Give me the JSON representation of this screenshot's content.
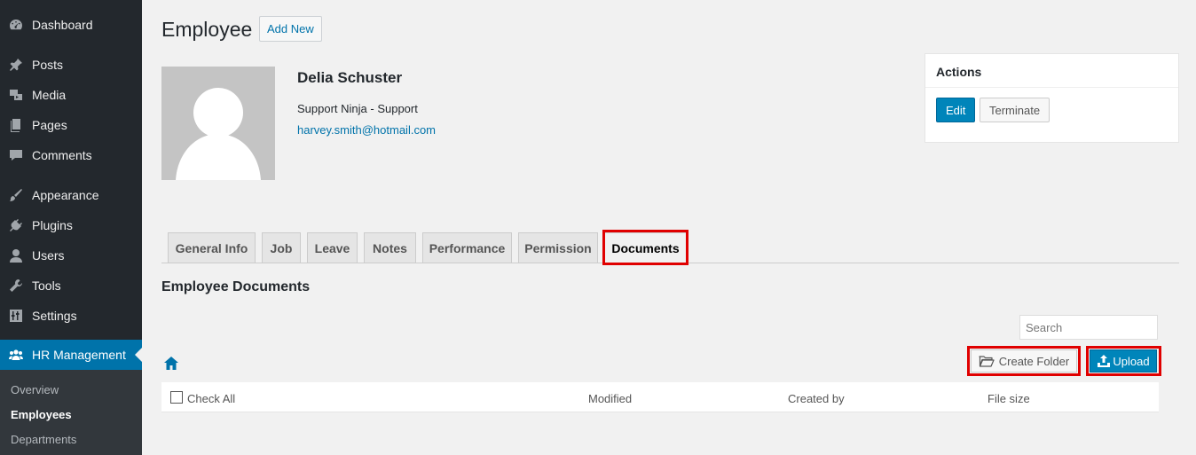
{
  "sidebar": {
    "items": [
      {
        "label": "Dashboard",
        "icon": "dashboard-icon"
      },
      {
        "label": "Posts",
        "icon": "pin-icon"
      },
      {
        "label": "Media",
        "icon": "media-icon"
      },
      {
        "label": "Pages",
        "icon": "pages-icon"
      },
      {
        "label": "Comments",
        "icon": "comment-icon"
      },
      {
        "label": "Appearance",
        "icon": "brush-icon"
      },
      {
        "label": "Plugins",
        "icon": "plug-icon"
      },
      {
        "label": "Users",
        "icon": "user-icon"
      },
      {
        "label": "Tools",
        "icon": "wrench-icon"
      },
      {
        "label": "Settings",
        "icon": "sliders-icon"
      },
      {
        "label": "HR Management",
        "icon": "group-icon"
      }
    ],
    "submenu": [
      "Overview",
      "Employees",
      "Departments"
    ]
  },
  "header": {
    "title": "Employee",
    "add_new": "Add New"
  },
  "profile": {
    "name": "Delia Schuster",
    "role": "Support Ninja - Support",
    "email": "harvey.smith@hotmail.com"
  },
  "actions": {
    "title": "Actions",
    "edit": "Edit",
    "terminate": "Terminate"
  },
  "tabs": [
    "General Info",
    "Job",
    "Leave",
    "Notes",
    "Performance",
    "Permission",
    "Documents"
  ],
  "documents": {
    "title": "Employee Documents",
    "search_placeholder": "Search",
    "create_folder": "Create Folder",
    "upload": "Upload",
    "columns": {
      "check_all": "Check All",
      "modified": "Modified",
      "created_by": "Created by",
      "file_size": "File size"
    }
  },
  "colors": {
    "accent": "#0073aa",
    "sidebar_bg": "#23282d",
    "highlight": "#e00000"
  }
}
